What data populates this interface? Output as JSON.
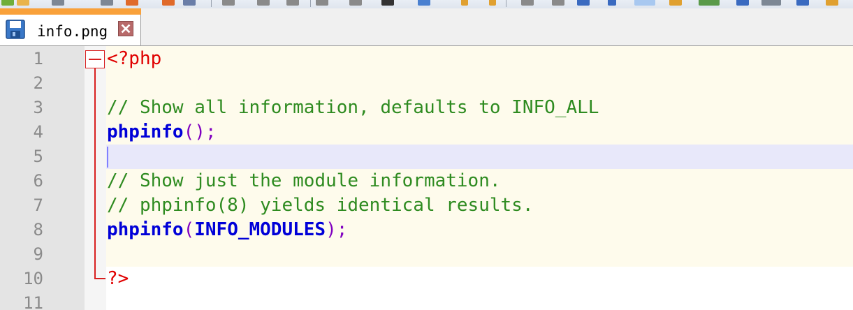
{
  "tab": {
    "filename": "info.png",
    "icon": "save-icon",
    "close_icon": "close-icon"
  },
  "editor": {
    "lines": [
      {
        "num": "1",
        "tokens": [
          {
            "t": "<?php",
            "c": "php-tag"
          }
        ]
      },
      {
        "num": "2",
        "tokens": []
      },
      {
        "num": "3",
        "tokens": [
          {
            "t": "// Show all information, defaults to INFO_ALL",
            "c": "comment"
          }
        ]
      },
      {
        "num": "4",
        "tokens": [
          {
            "t": "phpinfo",
            "c": "fn"
          },
          {
            "t": "();",
            "c": "paren"
          }
        ]
      },
      {
        "num": "5",
        "tokens": []
      },
      {
        "num": "6",
        "tokens": [
          {
            "t": "// Show just the module information.",
            "c": "comment"
          }
        ]
      },
      {
        "num": "7",
        "tokens": [
          {
            "t": "// phpinfo(8) yields identical results.",
            "c": "comment"
          }
        ]
      },
      {
        "num": "8",
        "tokens": [
          {
            "t": "phpinfo",
            "c": "fn"
          },
          {
            "t": "(",
            "c": "paren"
          },
          {
            "t": "INFO_MODULES",
            "c": "const"
          },
          {
            "t": ");",
            "c": "paren"
          }
        ]
      },
      {
        "num": "9",
        "tokens": []
      },
      {
        "num": "10",
        "tokens": [
          {
            "t": "?>",
            "c": "php-tag"
          }
        ]
      },
      {
        "num": "11",
        "tokens": []
      }
    ],
    "current_line": 5
  },
  "colors": {
    "tab_accent": "#f9a13a",
    "php_tag": "#e00000",
    "comment": "#2e8b20",
    "keyword": "#0000d8",
    "operator": "#8000c0",
    "fold_marker": "#d82020"
  }
}
